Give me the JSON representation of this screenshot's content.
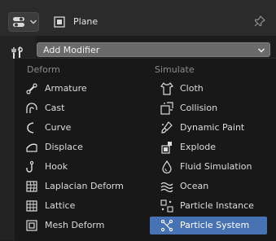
{
  "header": {
    "object_name": "Plane"
  },
  "add_modifier": {
    "label": "Add Modifier"
  },
  "menu": {
    "deform": {
      "heading": "Deform",
      "items": [
        "Armature",
        "Cast",
        "Curve",
        "Displace",
        "Hook",
        "Laplacian Deform",
        "Lattice",
        "Mesh Deform"
      ]
    },
    "simulate": {
      "heading": "Simulate",
      "items": [
        "Cloth",
        "Collision",
        "Dynamic Paint",
        "Explode",
        "Fluid Simulation",
        "Ocean",
        "Particle Instance",
        "Particle System"
      ],
      "selected": "Particle System"
    }
  },
  "colors": {
    "selection": "#4772b3",
    "menu_bg": "#181818",
    "header_bg": "#2b2b2b"
  }
}
